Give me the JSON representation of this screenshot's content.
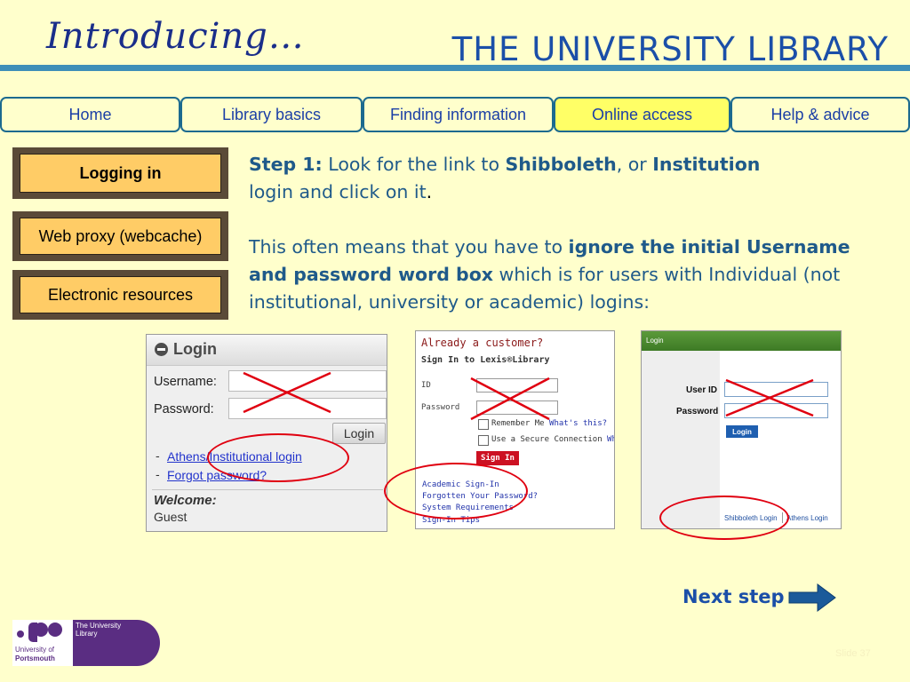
{
  "header": {
    "intro": "Introducing…",
    "title": "THE UNIVERSITY LIBRARY"
  },
  "nav": {
    "tabs": [
      {
        "label": "Home"
      },
      {
        "label": "Library basics"
      },
      {
        "label": "Finding information"
      },
      {
        "label": "Online access"
      },
      {
        "label": "Help & advice"
      }
    ],
    "active": "Online access"
  },
  "sidebar": {
    "items": [
      {
        "label": "Logging in"
      },
      {
        "label": "Web proxy (webcache)"
      },
      {
        "label": "Electronic resources"
      }
    ]
  },
  "content": {
    "step_label": "Step 1:",
    "p1_a": " Look for the link to ",
    "p1_b": "Shibboleth",
    "p1_c": ", or ",
    "p1_d": "Institution",
    "p1_e": " login and click on it",
    "p1_f": ".",
    "p2_a": "This often means that you have to ",
    "p2_b": "ignore the initial Username and password word box",
    "p2_c": " which is for users with Individual (not institutional, university or academic) logins:"
  },
  "shot1": {
    "heading": "Login",
    "username_label": "Username:",
    "password_label": "Password:",
    "login_button": "Login",
    "link1": "Athens/Institutional login",
    "link2": "Forgot password?",
    "welcome": "Welcome:",
    "guest": "Guest"
  },
  "shot2": {
    "heading": "Already a customer?",
    "subheading": "Sign In to Lexis®Library",
    "id_label": "ID",
    "password_label": "Password",
    "remember": "Remember Me",
    "whats_this": "What's this?",
    "secure": "Use a Secure Connection",
    "secure_link": "Wh",
    "sign_in": "Sign In",
    "links": [
      "Academic Sign-In",
      "Forgotten Your Password?",
      "System Requirements",
      "Sign-In Tips"
    ]
  },
  "shot3": {
    "header": "Login",
    "user_id": "User ID",
    "password": "Password",
    "login_button": "Login",
    "shib_link": "Shibboleth Login",
    "athens_link": "Athens Login"
  },
  "footer": {
    "next_step": "Next step",
    "logo_university_line1": "University of",
    "logo_university_line2": "Portsmouth",
    "logo_library": "The University Library",
    "slide_number": "Slide 37"
  },
  "colors": {
    "background": "#ffffcc",
    "accent": "#1b4fa8",
    "tab_active": "#ffff66",
    "sidebar_fill": "#ffcc66",
    "annotation_red": "#e00010",
    "logo_purple": "#5a2d82"
  }
}
